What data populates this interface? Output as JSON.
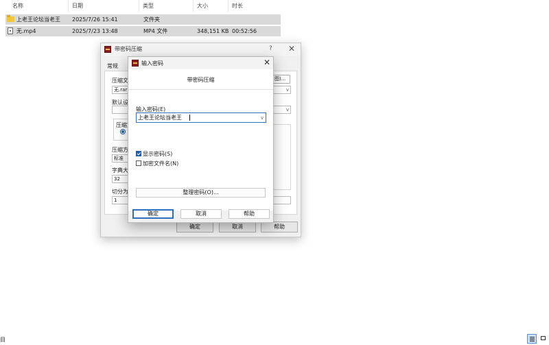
{
  "explorer": {
    "columns": {
      "name": "名称",
      "date": "日期",
      "type": "类型",
      "size": "大小",
      "duration": "时长"
    },
    "files": [
      {
        "name": "上老王论坛当老王",
        "date": "2025/7/26 15:41",
        "type": "文件夹",
        "size": "",
        "duration": "",
        "icon": "folder-icon"
      },
      {
        "name": "无.mp4",
        "date": "2025/7/23 13:48",
        "type": "MP4 文件",
        "size": "348,151 KB",
        "duration": "00:52:56",
        "icon": "video-file-icon"
      }
    ],
    "status_fragment": "目"
  },
  "archive_dialog": {
    "title": "带密码压缩",
    "help_glyph": "?",
    "close_glyph": "✕",
    "tab_general": "常规",
    "label_archive_name": "压缩文",
    "archive_name_value": "无.rar",
    "browse_fragment": "图)...",
    "label_default_settings": "默认设",
    "label_format": "压缩文",
    "label_method": "压缩方",
    "method_value": "标准",
    "label_dictionary": "字典大",
    "dictionary_value": "32",
    "label_split": "切分为",
    "split_value": "1",
    "ok": "确定",
    "cancel": "取消",
    "help": "帮助"
  },
  "password_dialog": {
    "title": "输入密码",
    "close_glyph": "✕",
    "subtitle": "带密码压缩",
    "password_label": "输入密码(E)",
    "password_value": "上老王论坛当老王",
    "show_password_label": "显示密码(S)",
    "show_password_checked": true,
    "encrypt_filenames_label": "加密文件名(N)",
    "encrypt_filenames_checked": false,
    "organize_button": "整理密码(O)...",
    "ok": "确定",
    "cancel": "取消",
    "help": "帮助"
  },
  "colors": {
    "accent": "#1f5fa8",
    "selection": "#d9d9d9",
    "dialog_bg": "#f0f0f0"
  }
}
